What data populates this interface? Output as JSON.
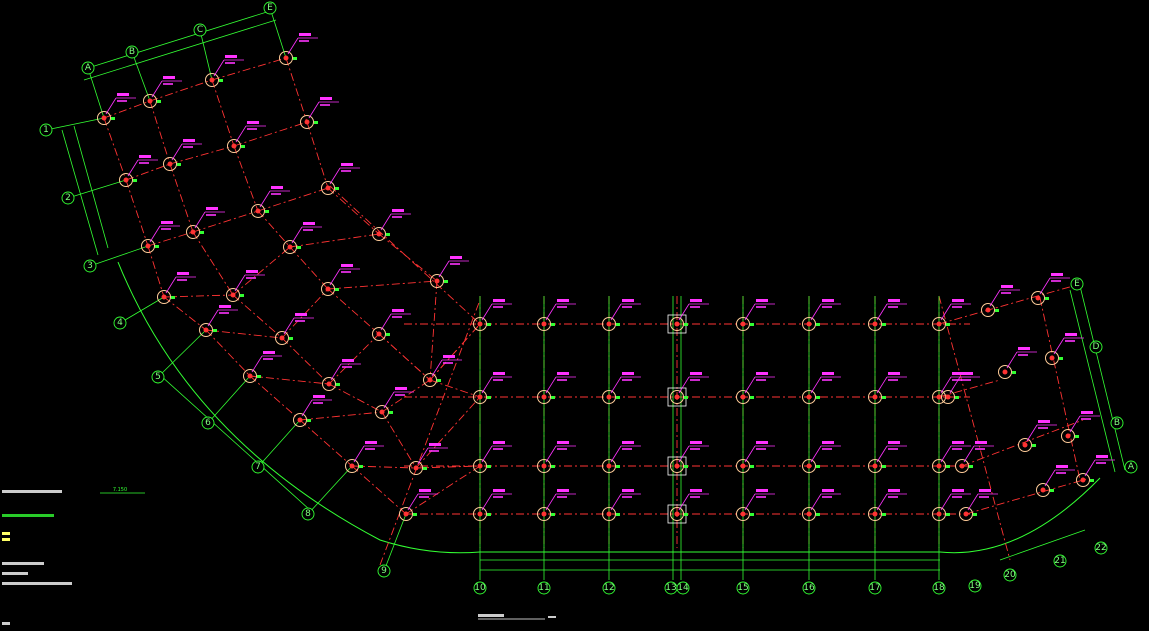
{
  "axis_labels_top": [
    "A",
    "B",
    "C",
    "E"
  ],
  "axis_labels_left": [
    "1",
    "2",
    "3",
    "4",
    "5",
    "6",
    "7",
    "8",
    "9"
  ],
  "axis_labels_bottom": [
    "10",
    "11",
    "12",
    "13",
    "14",
    "15",
    "16",
    "17",
    "18",
    "19",
    "20",
    "21",
    "22"
  ],
  "axis_labels_right": [
    "E",
    "D",
    "B",
    "A"
  ],
  "scale_label": "7.150",
  "colors": {
    "background": "#000000",
    "axis_green": "#33ff33",
    "grid_red": "#ff3333",
    "column_marker": "#ffcc99",
    "annotation_magenta": "#ff33ff"
  }
}
